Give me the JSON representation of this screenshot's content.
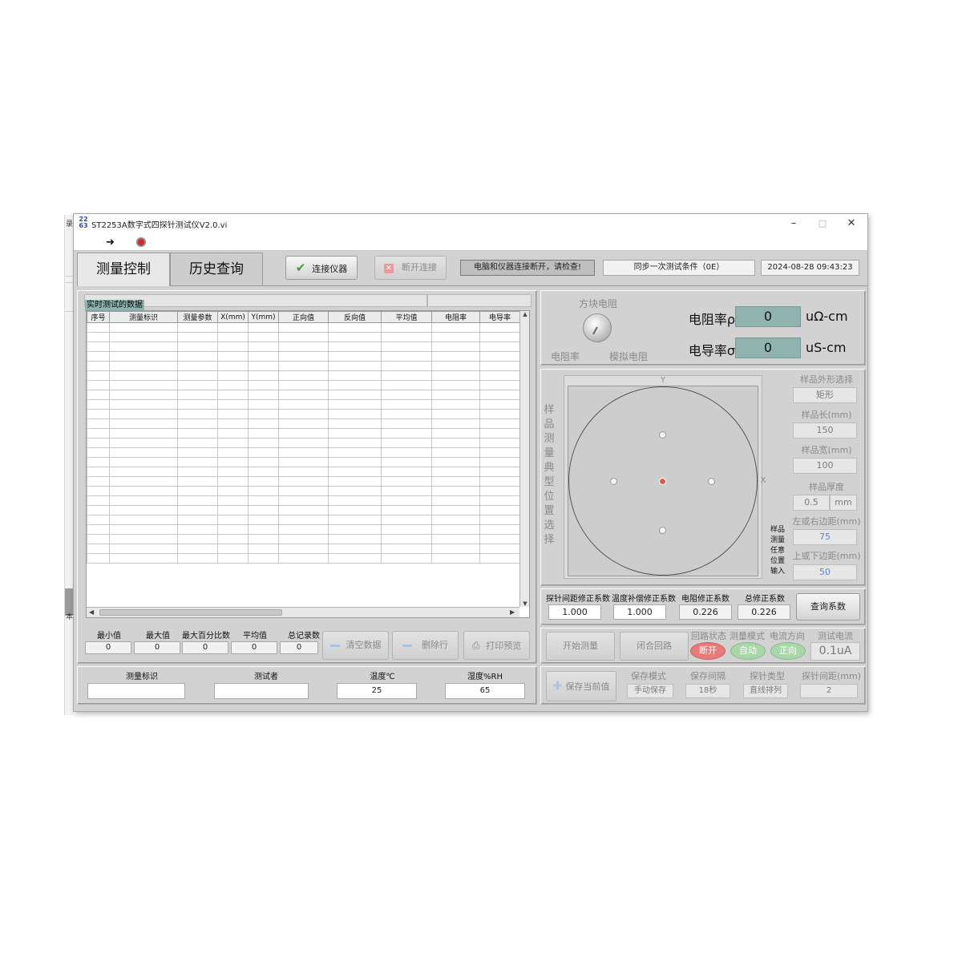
{
  "background_window": {
    "text_top": "录",
    "text_bottom": "本"
  },
  "window": {
    "app_icon_text": "22\n63",
    "title": "ST2253A数字式四探针测试仪V2.0.vi",
    "minimize": "–",
    "maximize": "□",
    "close": "✕"
  },
  "toolbar": {
    "run_icon": "➜"
  },
  "tabs": [
    {
      "label": "测量控制",
      "active": true
    },
    {
      "label": "历史查询",
      "active": false
    }
  ],
  "header": {
    "connect_label": "连接仪器",
    "disconnect_label": "断开连接",
    "status": "电脑和仪器连接断开，请检查!",
    "sync": "同步一次测试条件（0E）",
    "datetime": "2024-08-28 09:43:23"
  },
  "table": {
    "title": "实时测试的数据",
    "columns": [
      "序号",
      "测量标识",
      "测量参数",
      "X(mm)",
      "Y(mm)",
      "正向值",
      "反向值",
      "平均值",
      "电阻率",
      "电导率"
    ]
  },
  "stats": {
    "labels": [
      "最小值",
      "最大值",
      "最大百分比数",
      "平均值",
      "总记录数"
    ],
    "values": [
      "0",
      "0",
      "0",
      "0",
      "0"
    ]
  },
  "data_buttons": {
    "clear": "清空数据",
    "delete": "删除行",
    "print": "打印预览"
  },
  "bottom_left": {
    "id_label": "测量标识",
    "id_value": "",
    "tester_label": "测试者",
    "tester_value": "",
    "temp_label": "温度℃",
    "temp_value": "25",
    "humidity_label": "湿度%RH",
    "humidity_value": "65"
  },
  "knob": {
    "top_label": "方块电阻",
    "left_label": "电阻率",
    "right_label": "模拟电阻"
  },
  "readouts": {
    "resistivity_label": "电阻率ρ",
    "resistivity_value": "0",
    "resistivity_unit": "uΩ-cm",
    "conductivity_label": "电导率σ",
    "conductivity_value": "0",
    "conductivity_unit": "uS-cm"
  },
  "sample": {
    "vertical_title": [
      "样",
      "品",
      "测",
      "量",
      "典",
      "型",
      "位",
      "置",
      "选",
      "择"
    ],
    "axis_x": "X",
    "axis_y": "Y",
    "shape_label": "样品外形选择",
    "shape_value": "矩形",
    "length_label": "样品长(mm)",
    "length_value": "150",
    "width_label": "样品宽(mm)",
    "width_value": "100",
    "thickness_label": "样品厚度",
    "thickness_value": "0.5",
    "thickness_unit": "mm",
    "lr_margin_label": "左或右边距(mm)",
    "lr_margin_value": "75",
    "tb_margin_label": "上或下边距(mm)",
    "tb_margin_value": "50",
    "arbitrary_label": [
      "样品",
      "测量",
      "任意",
      "位置",
      "输入"
    ]
  },
  "coefficients": {
    "probe_label": "探针间距修正系数",
    "probe_value": "1.000",
    "temp_label": "温度补偿修正系数",
    "temp_value": "1.000",
    "resist_label": "电阻修正系数",
    "resist_value": "0.226",
    "total_label": "总修正系数",
    "total_value": "0.226",
    "query_button": "查询系数"
  },
  "measure": {
    "start_button": "开始测量",
    "close_loop_button": "闭合回路",
    "loop_state_label": "回路状态",
    "loop_state_value": "断开",
    "mode_label": "测量模式",
    "mode_value": "自动",
    "direction_label": "电流方向",
    "direction_value": "正向",
    "current_label": "测试电流",
    "current_value": "0.1uA"
  },
  "save": {
    "save_button": "保存当前值",
    "mode_label": "保存模式",
    "mode_value": "手动保存",
    "interval_label": "保存间隔",
    "interval_value": "18秒",
    "probe_type_label": "探针类型",
    "probe_type_value": "直线排列",
    "probe_spacing_label": "探针间距(mm)",
    "probe_spacing_value": "2"
  },
  "colors": {
    "readout_bg": "#8fb4b0",
    "status_bg": "#bfbfbf",
    "led_red": "#e87a7a",
    "led_green": "#a8d8a8",
    "center_dot": "#e05a4a"
  }
}
